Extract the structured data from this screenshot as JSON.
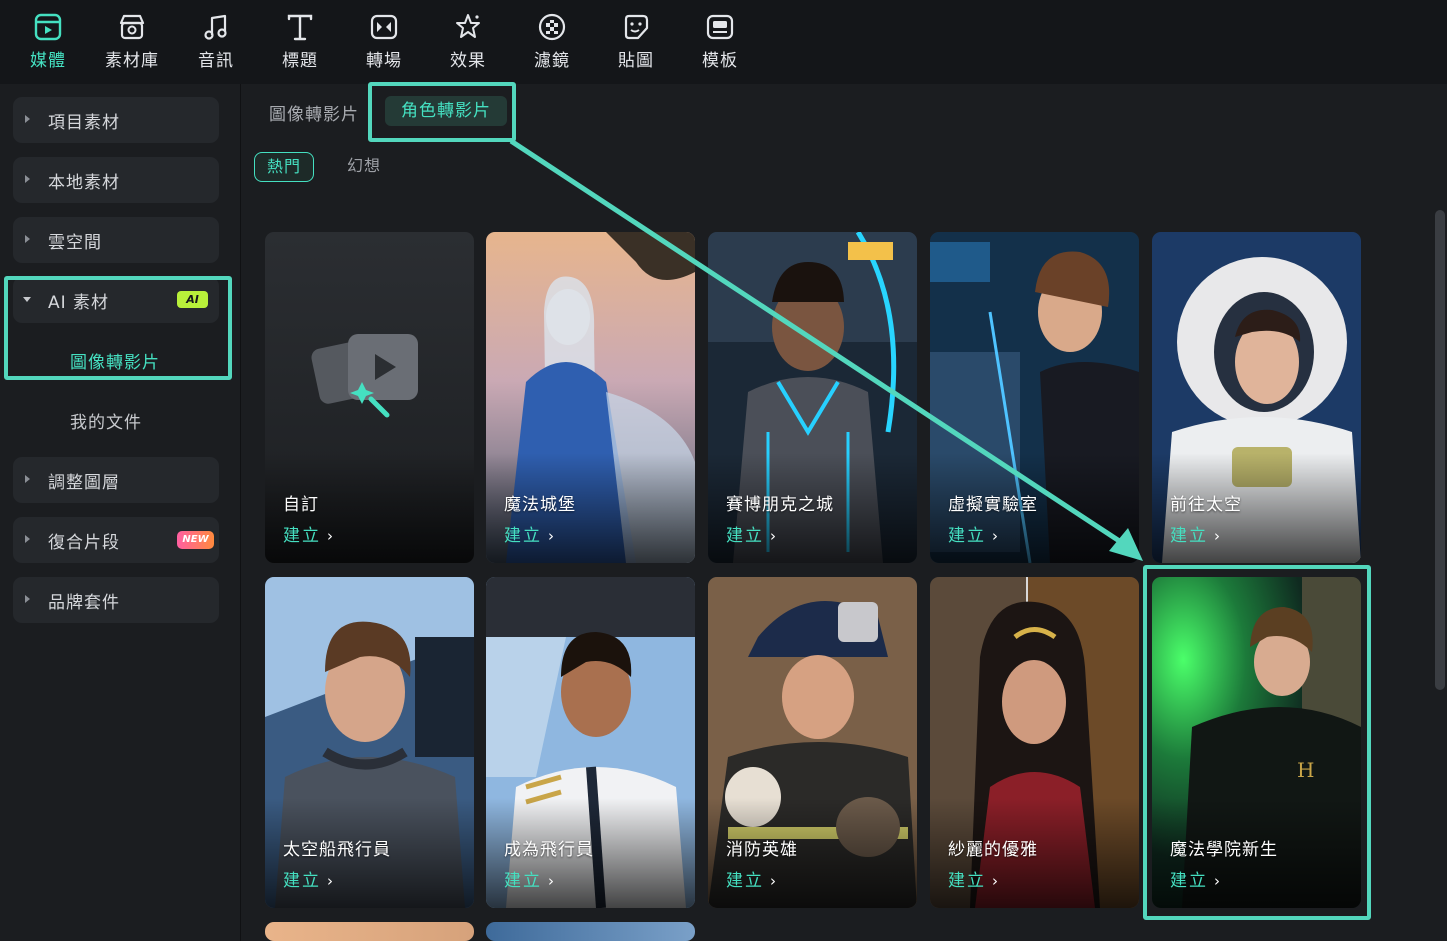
{
  "toolbar": {
    "items": [
      {
        "label": "媒體",
        "icon": "media-icon",
        "active": true
      },
      {
        "label": "素材庫",
        "icon": "stock-library-icon"
      },
      {
        "label": "音訊",
        "icon": "music-note-icon"
      },
      {
        "label": "標題",
        "icon": "title-t-icon"
      },
      {
        "label": "轉場",
        "icon": "transition-icon"
      },
      {
        "label": "效果",
        "icon": "effects-star-icon"
      },
      {
        "label": "濾鏡",
        "icon": "filter-icon"
      },
      {
        "label": "貼圖",
        "icon": "sticker-icon"
      },
      {
        "label": "模板",
        "icon": "template-icon"
      }
    ],
    "accent": "#45e0c1"
  },
  "sidebar": {
    "items": [
      {
        "label": "項目素材"
      },
      {
        "label": "本地素材"
      },
      {
        "label": "雲空間"
      },
      {
        "label": "AI 素材",
        "badge": "AI",
        "expanded": true
      },
      {
        "label": "調整圖層"
      },
      {
        "label": "復合片段",
        "badge": "NEW"
      },
      {
        "label": "品牌套件"
      }
    ],
    "sub_items": [
      {
        "label": "圖像轉影片",
        "active": true
      },
      {
        "label": "我的文件"
      }
    ]
  },
  "main": {
    "tabs": [
      {
        "label": "圖像轉影片"
      },
      {
        "label": "角色轉影片",
        "active": true
      }
    ],
    "chips": [
      {
        "label": "熱門",
        "active": true
      },
      {
        "label": "幻想"
      }
    ],
    "cards": [
      {
        "title": "自訂",
        "create": "建立"
      },
      {
        "title": "魔法城堡",
        "create": "建立"
      },
      {
        "title": "賽博朋克之城",
        "create": "建立"
      },
      {
        "title": "虛擬實驗室",
        "create": "建立"
      },
      {
        "title": "前往太空",
        "create": "建立"
      },
      {
        "title": "太空船飛行員",
        "create": "建立"
      },
      {
        "title": "成為飛行員",
        "create": "建立"
      },
      {
        "title": "消防英雄",
        "create": "建立"
      },
      {
        "title": "紗麗的優雅",
        "create": "建立"
      },
      {
        "title": "魔法學院新生",
        "create": "建立"
      }
    ]
  }
}
